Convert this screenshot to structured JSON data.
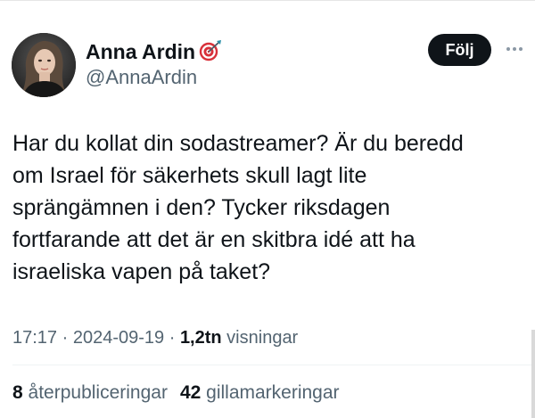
{
  "author": {
    "name": "Anna Ardin",
    "handle": "@AnnaArdin",
    "badge_icon": "target-icon",
    "avatar_icon": "profile-photo"
  },
  "actions": {
    "follow_label": "Följ",
    "more_icon": "more-horizontal-icon"
  },
  "tweet": {
    "lines": [
      "Har du kollat din sodastreamer? Är du beredd",
      "om Israel för säkerhets skull lagt lite",
      "sprängämnen i den? Tycker riksdagen",
      "fortfarande att det är en skitbra idé att ha",
      "israeliska vapen på taket?"
    ]
  },
  "meta": {
    "time": "17:17",
    "separator": " · ",
    "date": "2024-09-19",
    "views_count": "1,2tn",
    "views_label": " visningar"
  },
  "stats": {
    "reposts_count": "8",
    "reposts_label": " återpubliceringar",
    "likes_count": "42",
    "likes_label": " gillamarkeringar"
  },
  "colors": {
    "text_primary": "#0f1419",
    "text_secondary": "#536471",
    "button_bg": "#0f1419",
    "button_text": "#ffffff"
  }
}
